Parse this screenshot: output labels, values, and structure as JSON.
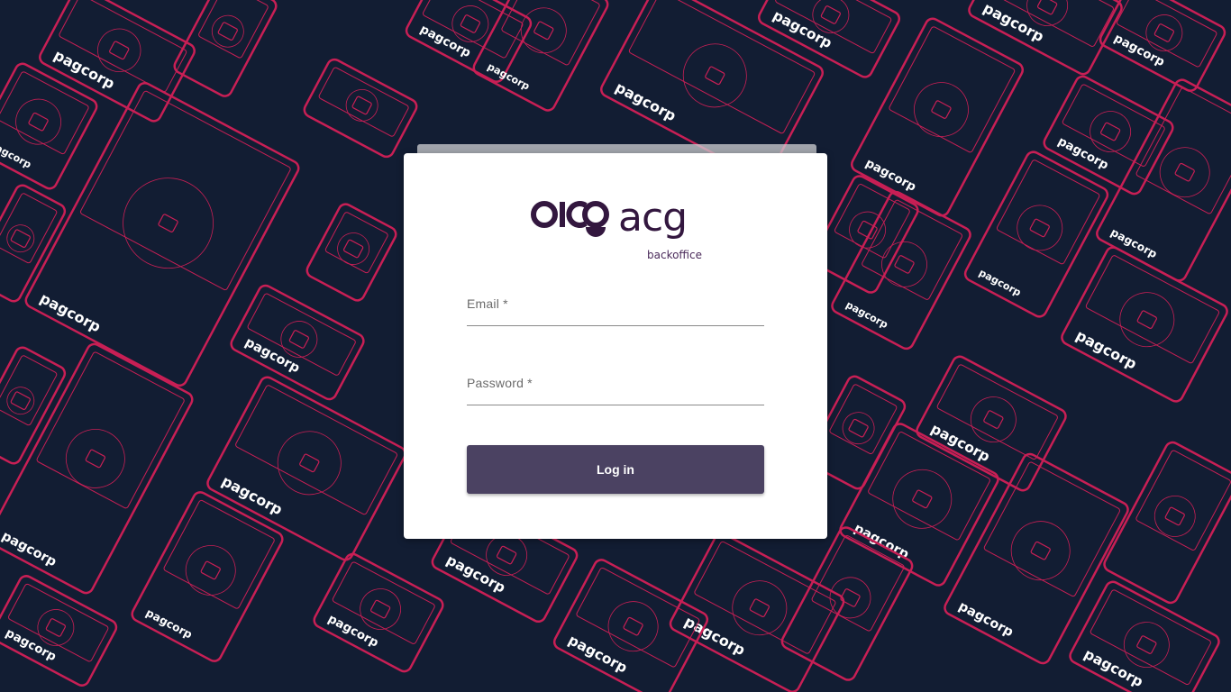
{
  "background": {
    "color": "#121d33",
    "line_color": "#c81f55",
    "pattern_brand_text": "pagcorp"
  },
  "login": {
    "logo": {
      "wordmark": "acg",
      "subtitle": "backoffice",
      "color": "#33173f"
    },
    "email": {
      "label": "Email *",
      "value": ""
    },
    "password": {
      "label": "Password *",
      "value": ""
    },
    "submit_label": "Log in",
    "button_color": "#4b4262"
  }
}
